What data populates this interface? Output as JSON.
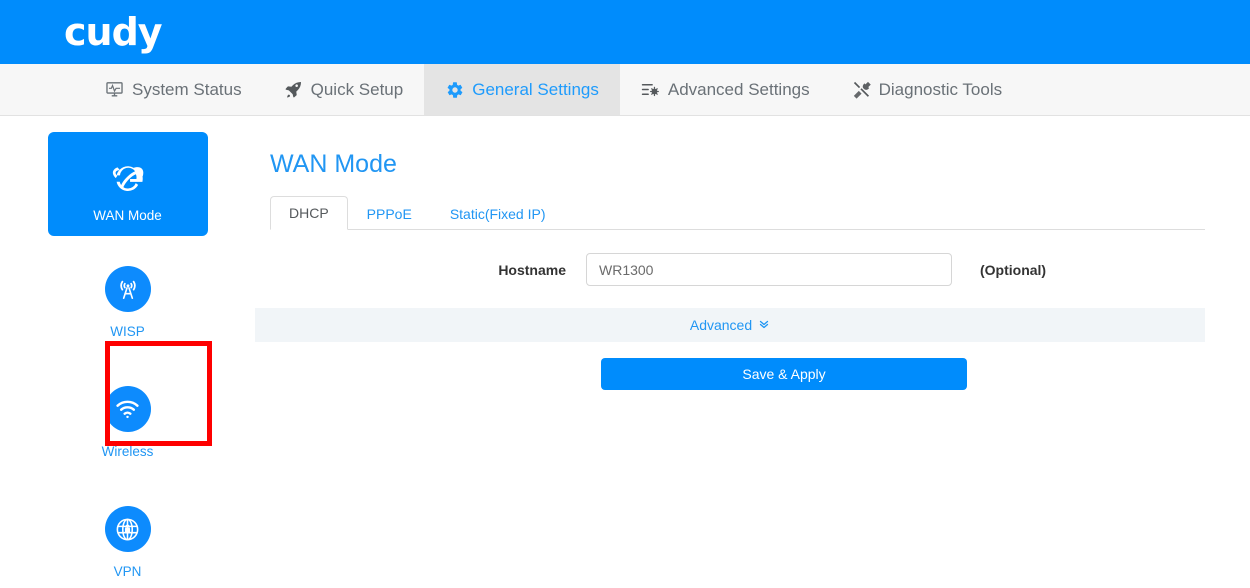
{
  "brand": {
    "logo_text": "cudy"
  },
  "nav": {
    "items": [
      {
        "label": "System Status",
        "icon": "monitor-pulse-icon",
        "active": false
      },
      {
        "label": "Quick Setup",
        "icon": "rocket-icon",
        "active": false
      },
      {
        "label": "General Settings",
        "icon": "gear-icon",
        "active": true
      },
      {
        "label": "Advanced Settings",
        "icon": "sliders-gear-icon",
        "active": false
      },
      {
        "label": "Diagnostic Tools",
        "icon": "tools-icon",
        "active": false
      }
    ]
  },
  "sidebar": {
    "items": [
      {
        "label": "WAN Mode",
        "icon": "internet-explorer-e-icon",
        "active": true
      },
      {
        "label": "WISP",
        "icon": "broadcast-tower-icon",
        "active": false
      },
      {
        "label": "Wireless",
        "icon": "wifi-icon",
        "active": false,
        "highlighted": true
      },
      {
        "label": "VPN",
        "icon": "globe-lock-icon",
        "active": false
      }
    ]
  },
  "main": {
    "title": "WAN Mode",
    "tabs": [
      {
        "label": "DHCP",
        "active": true
      },
      {
        "label": "PPPoE",
        "active": false
      },
      {
        "label": "Static(Fixed IP)",
        "active": false
      }
    ],
    "form": {
      "hostname_label": "Hostname",
      "hostname_value": "WR1300",
      "hostname_placeholder": "",
      "hostname_hint": "(Optional)"
    },
    "advanced_label": "Advanced",
    "advanced_chevron": "»",
    "save_label": "Save & Apply"
  },
  "colors": {
    "brand_blue": "#008cfc",
    "link_blue": "#2196f3",
    "nav_bg": "#f7f7f7",
    "nav_active_bg": "#e4e4e4",
    "advanced_bg": "#f1f5f8",
    "annotation_red": "#fe0000"
  }
}
